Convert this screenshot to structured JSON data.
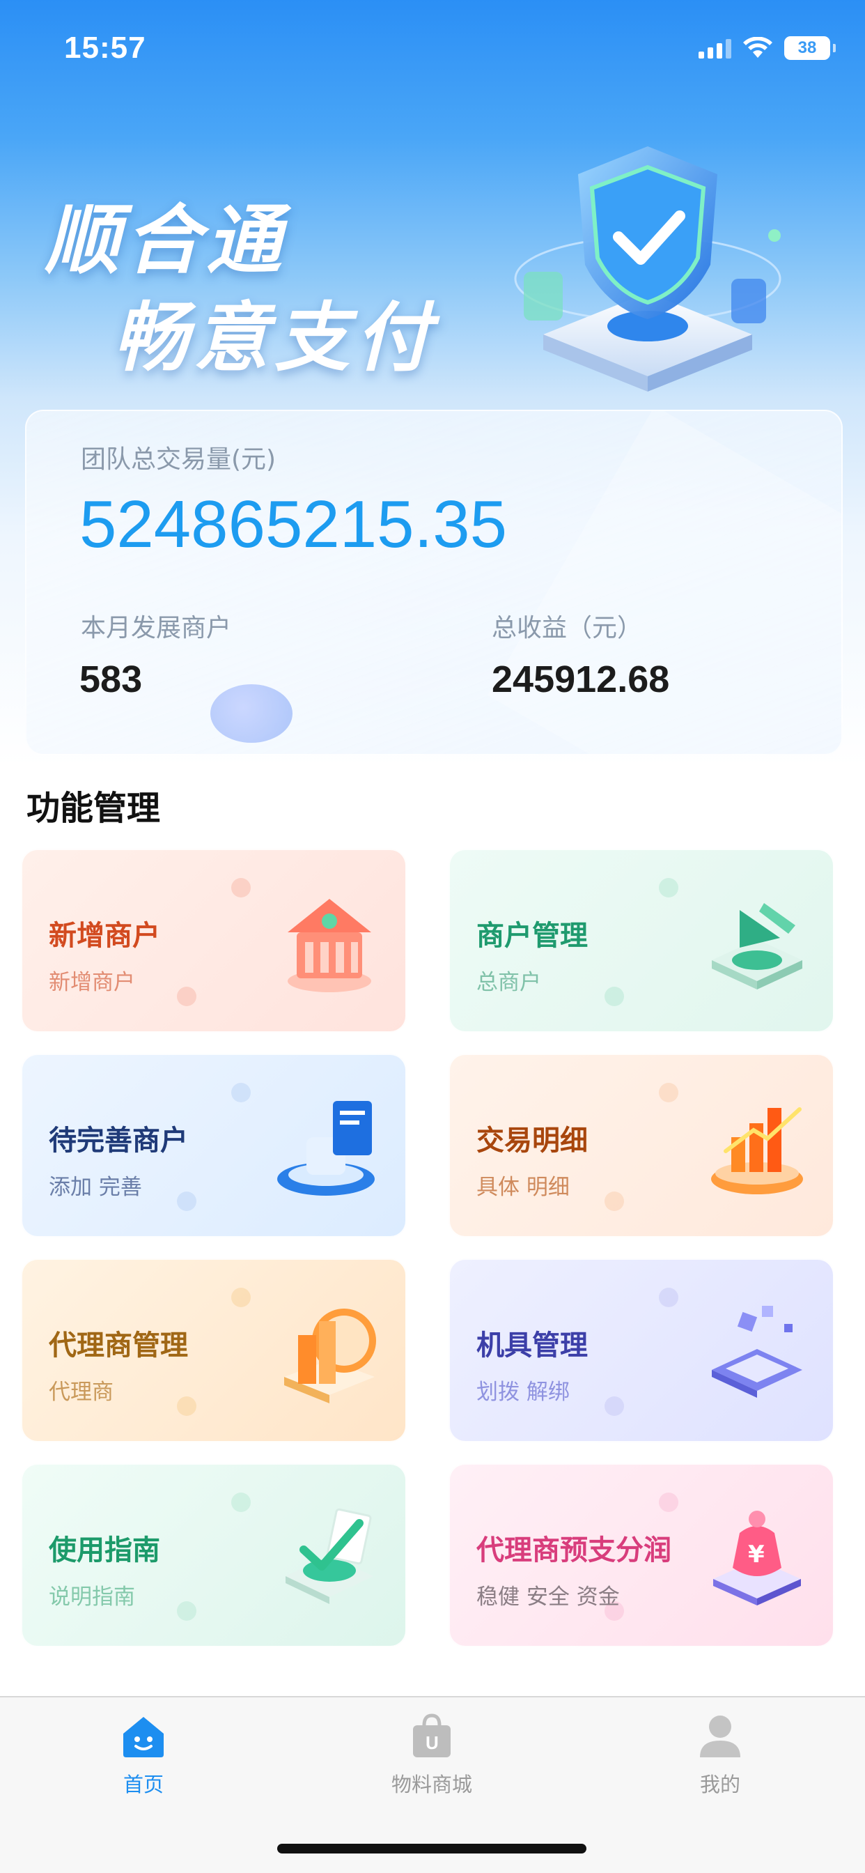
{
  "status_bar": {
    "time": "15:57",
    "battery": "38"
  },
  "hero": {
    "slogan_line1": "顺合通",
    "slogan_line2": "畅意支付"
  },
  "stats": {
    "total_label": "团队总交易量(元)",
    "total_value": "524865215.35",
    "month_label": "本月发展商户",
    "month_value": "583",
    "income_label": "总收益（元）",
    "income_value": "245912.68"
  },
  "section": {
    "title": "功能管理"
  },
  "features": [
    {
      "title": "新增商户",
      "subtitle": "新增商户",
      "icon": "house-icon"
    },
    {
      "title": "商户管理",
      "subtitle": "总商户",
      "icon": "merchant-platform-icon"
    },
    {
      "title": "待完善商户",
      "subtitle": "添加 完善",
      "icon": "document-stack-icon"
    },
    {
      "title": "交易明细",
      "subtitle": "具体 明细",
      "icon": "bar-chart-icon"
    },
    {
      "title": "代理商管理",
      "subtitle": "代理商",
      "icon": "building-icon"
    },
    {
      "title": "机具管理",
      "subtitle": "划拨 解绑",
      "icon": "device-icon"
    },
    {
      "title": "使用指南",
      "subtitle": "说明指南",
      "icon": "guide-check-icon"
    },
    {
      "title": "代理商预支分润",
      "subtitle": "稳健 安全 资金",
      "icon": "money-bag-icon"
    }
  ],
  "tabbar": {
    "home": "首页",
    "shop": "物料商城",
    "mine": "我的"
  },
  "colors": {
    "accent": "#1d8ef0",
    "hero_top": "#2b8ff5"
  }
}
